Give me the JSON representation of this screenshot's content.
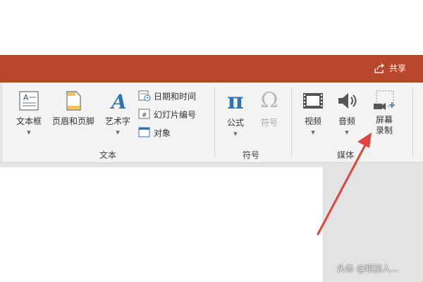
{
  "titlebar": {
    "share_label": "共享",
    "accent": "#b7472a"
  },
  "ribbon": {
    "groups": [
      {
        "label": "文本",
        "commands": [
          {
            "label": "文本框",
            "icon": "text-box-icon"
          },
          {
            "label": "页眉和页脚",
            "icon": "header-footer-icon"
          },
          {
            "label": "艺术字",
            "icon": "wordart-icon"
          }
        ],
        "small_commands": [
          {
            "label": "日期和时间",
            "icon": "date-time-icon"
          },
          {
            "label": "幻灯片编号",
            "icon": "slide-number-icon"
          },
          {
            "label": "对象",
            "icon": "object-icon"
          }
        ]
      },
      {
        "label": "符号",
        "commands": [
          {
            "label": "公式",
            "icon": "equation-icon",
            "glyph": "π"
          },
          {
            "label": "符号",
            "icon": "symbol-icon",
            "glyph": "Ω"
          }
        ]
      },
      {
        "label": "媒体",
        "commands": [
          {
            "label": "视频",
            "icon": "video-icon"
          },
          {
            "label": "音频",
            "icon": "audio-icon"
          },
          {
            "label_line1": "屏幕",
            "label_line2": "录制",
            "icon": "screen-recording-icon"
          }
        ]
      }
    ]
  },
  "annotation": {
    "color": "#e0443c"
  },
  "watermark": "头条 @眼前人..."
}
